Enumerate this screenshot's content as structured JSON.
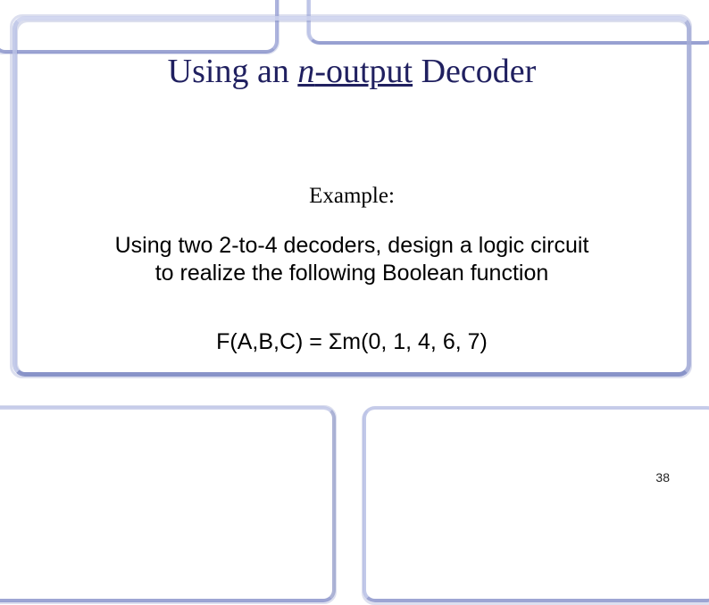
{
  "title": {
    "prefix": "Using an ",
    "n": "n",
    "output": "-output",
    "suffix": " Decoder"
  },
  "example_label": "Example:",
  "body_line1": "Using two 2-to-4 decoders, design a logic circuit",
  "body_line2": "to realize the following Boolean function",
  "formula": "F(A,B,C) = Σm(0, 1, 4, 6, 7)",
  "page_number": "38"
}
